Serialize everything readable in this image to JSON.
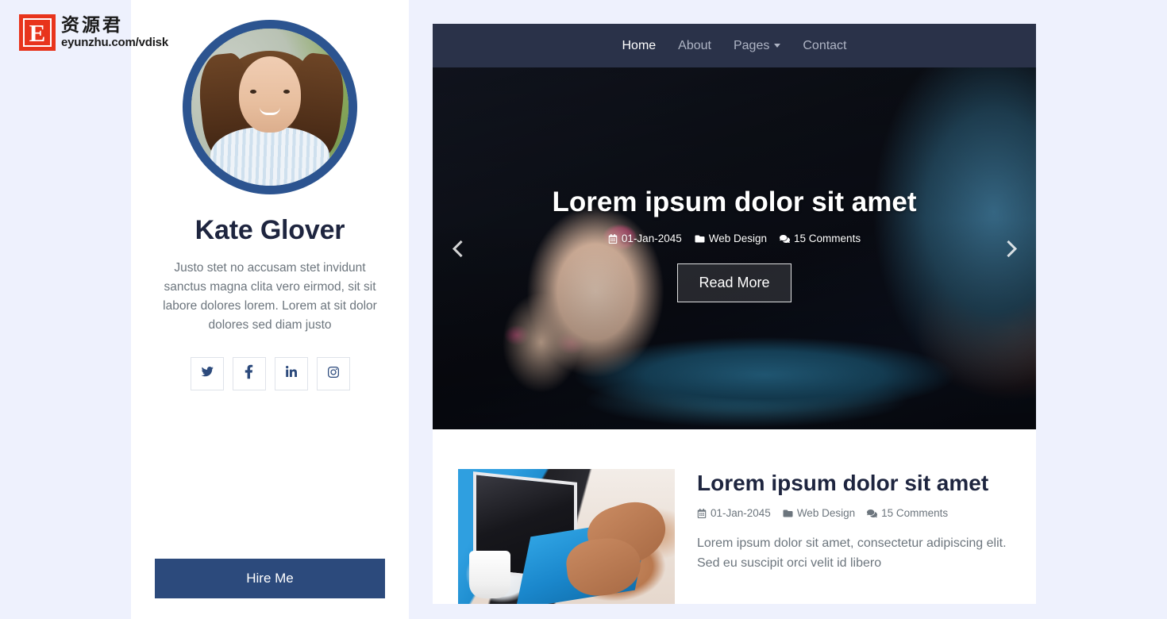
{
  "watermark": {
    "mark_letter": "E",
    "cn_text": "资源君",
    "url_text": "eyunzhu.com/vdisk"
  },
  "sidebar": {
    "avatar_alt": "profile-photo",
    "name": "Kate Glover",
    "bio": "Justo stet no accusam stet invidunt sanctus magna clita vero eirmod, sit sit labore dolores lorem. Lorem at sit dolor dolores sed diam justo",
    "socials": [
      {
        "name": "twitter-icon",
        "label": "Twitter"
      },
      {
        "name": "facebook-icon",
        "label": "Facebook"
      },
      {
        "name": "linkedin-icon",
        "label": "LinkedIn"
      },
      {
        "name": "instagram-icon",
        "label": "Instagram"
      }
    ],
    "hire_label": "Hire Me"
  },
  "navbar": {
    "items": [
      {
        "label": "Home",
        "active": true,
        "dropdown": false
      },
      {
        "label": "About",
        "active": false,
        "dropdown": false
      },
      {
        "label": "Pages",
        "active": false,
        "dropdown": true
      },
      {
        "label": "Contact",
        "active": false,
        "dropdown": false
      }
    ]
  },
  "carousel": {
    "title": "Lorem ipsum dolor sit amet",
    "date": "01-Jan-2045",
    "category": "Web Design",
    "comments": "15 Comments",
    "read_more": "Read More",
    "prev_label": "Previous",
    "next_label": "Next"
  },
  "blog": {
    "title": "Lorem ipsum dolor sit amet",
    "date": "01-Jan-2045",
    "category": "Web Design",
    "comments": "15 Comments",
    "excerpt": "Lorem ipsum dolor sit amet, consectetur adipiscing elit. Sed eu suscipit orci velit id libero"
  },
  "colors": {
    "accent": "#2c4a7c",
    "navbar_bg": "#2a3249",
    "page_bg": "#eef1fd",
    "panel_bg": "#ffffff",
    "heading": "#1e253f",
    "muted": "#6c757d",
    "logo_red": "#e8341c"
  }
}
